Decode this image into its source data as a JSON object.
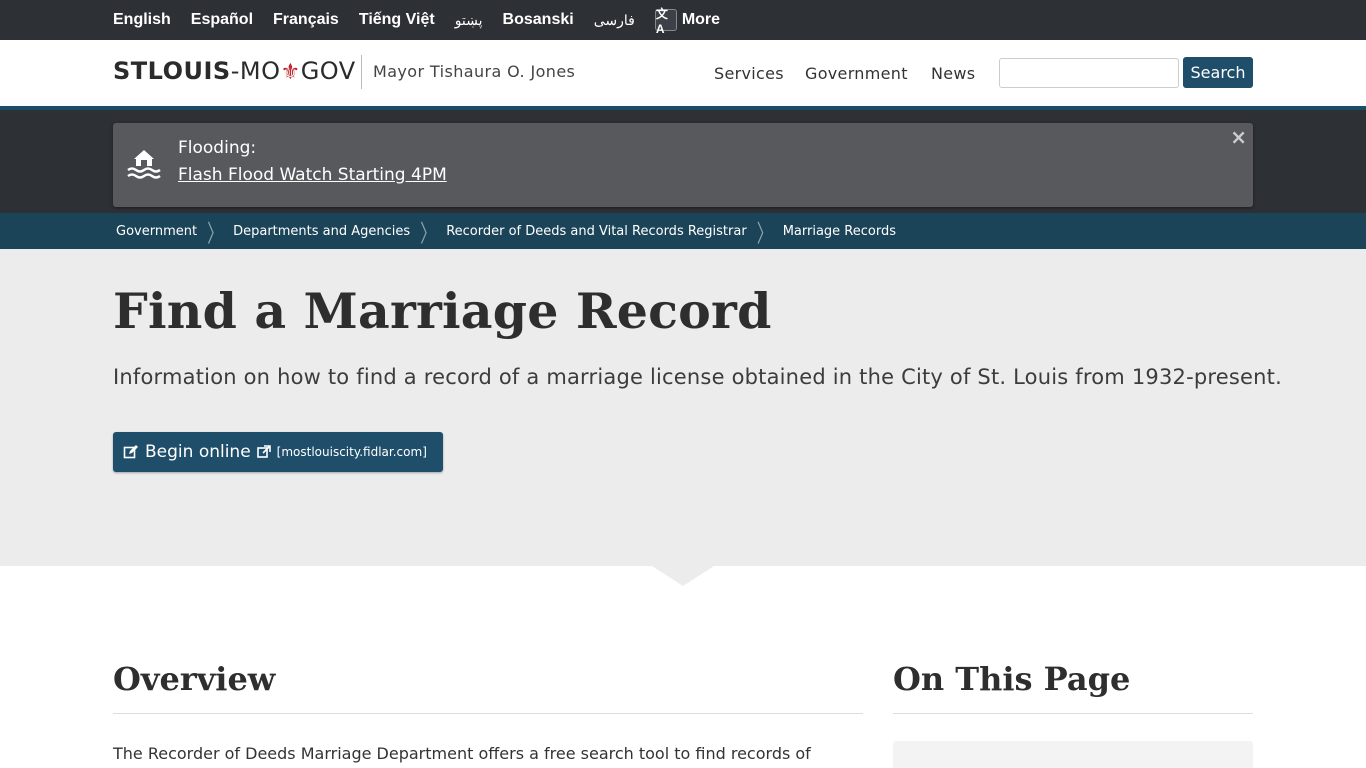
{
  "languages": {
    "items": [
      "English",
      "Español",
      "Français",
      "Tiếng Việt",
      "پښتو",
      "Bosanski",
      "فارسی"
    ],
    "more_label": "More",
    "more_icon": "translate-icon"
  },
  "header": {
    "logo_bold": "STLOUIS",
    "logo_sep": "-MO",
    "logo_fleur": "⚜",
    "logo_end": "GOV",
    "mayor": "Mayor Tishaura O. Jones",
    "nav": [
      "Services",
      "Government",
      "News"
    ],
    "search_value": "",
    "search_button": "Search"
  },
  "alert": {
    "icon": "flood-icon",
    "title": "Flooding:",
    "link": "Flash Flood Watch Starting 4PM",
    "close": "×"
  },
  "breadcrumb": [
    "Government",
    "Departments and Agencies",
    "Recorder of Deeds and Vital Records Registrar",
    "Marriage Records"
  ],
  "hero": {
    "title": "Find a Marriage Record",
    "lead": "Information on how to find a record of a marriage license obtained in the City of St. Louis from 1932-present.",
    "button_label": "Begin online",
    "button_domain": "[mostlouiscity.fidlar.com]"
  },
  "overview": {
    "title": "Overview",
    "text": "The Recorder of Deeds Marriage Department offers a free search tool to find records of"
  },
  "on_this_page": {
    "title": "On This Page"
  },
  "colors": {
    "topbar": "#2d3035",
    "accent": "#1f4e6b",
    "breadcrumb_bg": "#1b4458",
    "hero_bg": "#ececec",
    "alert_bg": "#57595c",
    "fleur": "#c0272d"
  }
}
